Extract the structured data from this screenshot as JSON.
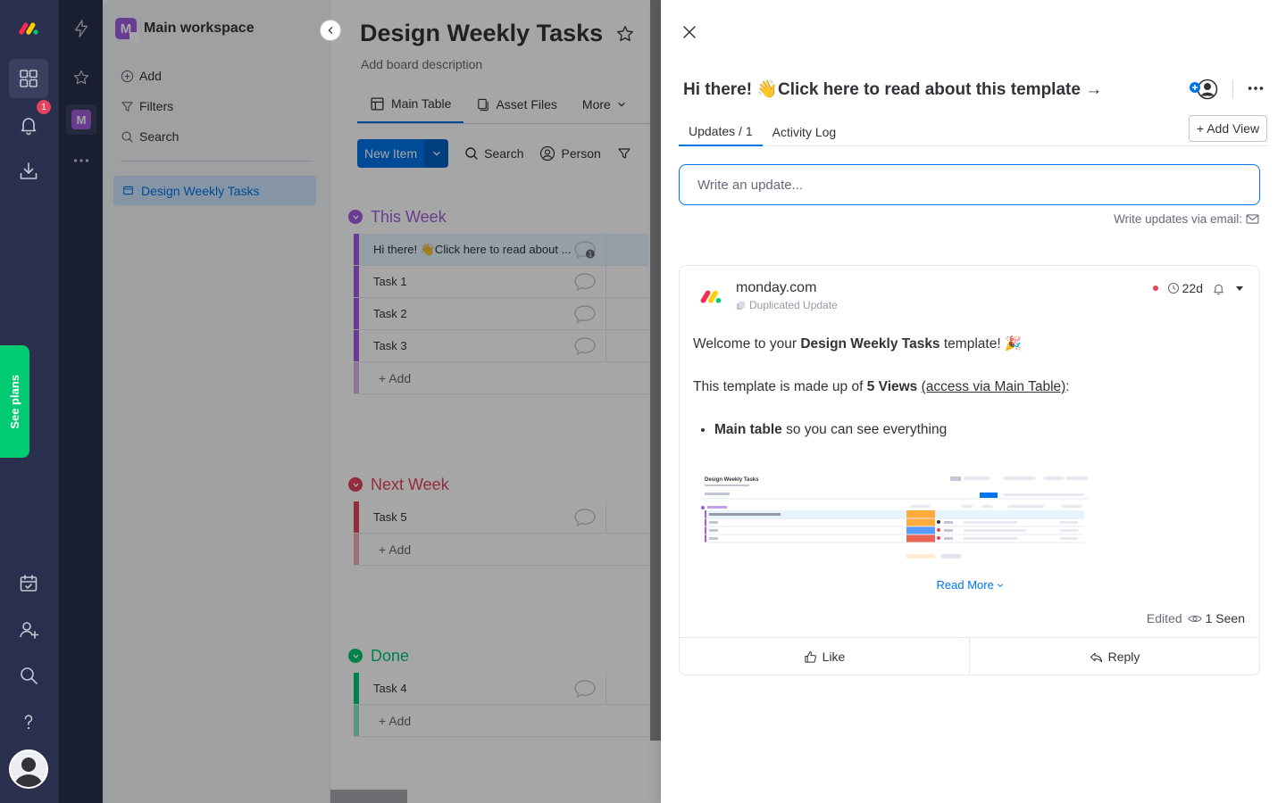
{
  "rail": {
    "badge_count": "1"
  },
  "see_plans": "See plans",
  "workspace": {
    "title": "Main workspace",
    "logo_letter": "M",
    "menu": [
      {
        "label": "Add",
        "icon": "plus-circle-icon"
      },
      {
        "label": "Filters",
        "icon": "filter-icon"
      },
      {
        "label": "Search",
        "icon": "search-icon"
      }
    ],
    "active_board": "Design Weekly Tasks"
  },
  "board": {
    "title": "Design Weekly Tasks",
    "description": "Add board description",
    "tabs": [
      {
        "label": "Main Table",
        "icon": "table-icon"
      },
      {
        "label": "Asset Files",
        "icon": "file-icon"
      },
      {
        "label": "More",
        "icon": "chevron-down-icon"
      }
    ],
    "toolbar": {
      "new_item": "New Item",
      "search": "Search",
      "person": "Person"
    },
    "groups": [
      {
        "name": "This Week",
        "color": "#a25ddc",
        "items": [
          "Hi there! 👋Click here to read about ...",
          "Task 1",
          "Task 2",
          "Task 3"
        ],
        "add_label": "+ Add"
      },
      {
        "name": "Next Week",
        "color": "#e2445c",
        "items": [
          "Task 5"
        ],
        "add_label": "+ Add"
      },
      {
        "name": "Done",
        "color": "#00c875",
        "items": [
          "Task 4"
        ],
        "add_label": "+ Add"
      }
    ],
    "first_item_update_count": "1"
  },
  "panel": {
    "title": "Hi there! 👋Click here to read about this template →",
    "tabs": [
      {
        "label": "Updates / 1"
      },
      {
        "label": "Activity Log"
      }
    ],
    "add_view": "+ Add View",
    "update_placeholder": "Write an update...",
    "email_hint": "Write updates via email:",
    "post": {
      "author": "monday.com",
      "duplicated": "Duplicated Update",
      "age": "22d",
      "welcome_prefix": "Welcome to your ",
      "welcome_bold": "Design Weekly Tasks",
      "welcome_suffix": " template! 🎉",
      "made_prefix": "This template is made up of ",
      "made_bold": "5 Views",
      "made_link": "(access via Main Table)",
      "made_suffix": ":",
      "bullet_bold": "Main table",
      "bullet_rest": " so you can see everything",
      "thumb_title": "Design Weekly Tasks",
      "read_more": "Read More",
      "edited": "Edited",
      "seen": "1 Seen",
      "like": "Like",
      "reply": "Reply"
    }
  },
  "colors": {
    "rail_bg": "#292f4c",
    "accent": "#0073ea",
    "see_plans": "#00ca72"
  }
}
